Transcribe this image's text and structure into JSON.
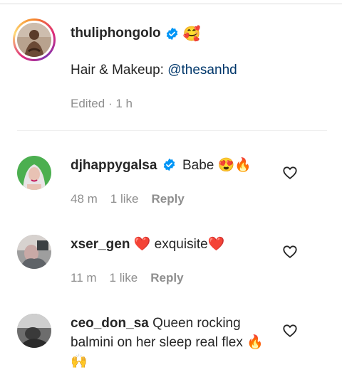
{
  "caption": {
    "username": "thuliphongolo",
    "verified": true,
    "emoji": "🥰",
    "text_prefix": "Hair & Makeup: ",
    "mention": "@thesanhd",
    "edited": "Edited",
    "separator": "·",
    "time": "1 h"
  },
  "comments": [
    {
      "username": "djhappygalsa",
      "verified": true,
      "text": "Babe 😍🔥",
      "time": "48 m",
      "likes": "1 like",
      "reply": "Reply"
    },
    {
      "username": "xser_gen",
      "verified": false,
      "text": "❤️ exquisite❤️",
      "time": "11 m",
      "likes": "1 like",
      "reply": "Reply"
    },
    {
      "username": "ceo_don_sa",
      "verified": false,
      "text": "Queen rocking balmini on her sleep real flex 🔥🙌"
    }
  ],
  "colors": {
    "verified_blue": "#0095f6",
    "mention_blue": "#00376b",
    "meta_grey": "#8e8e8e"
  },
  "icons": {
    "verified": "verified-badge-icon",
    "like": "heart-outline-icon"
  }
}
